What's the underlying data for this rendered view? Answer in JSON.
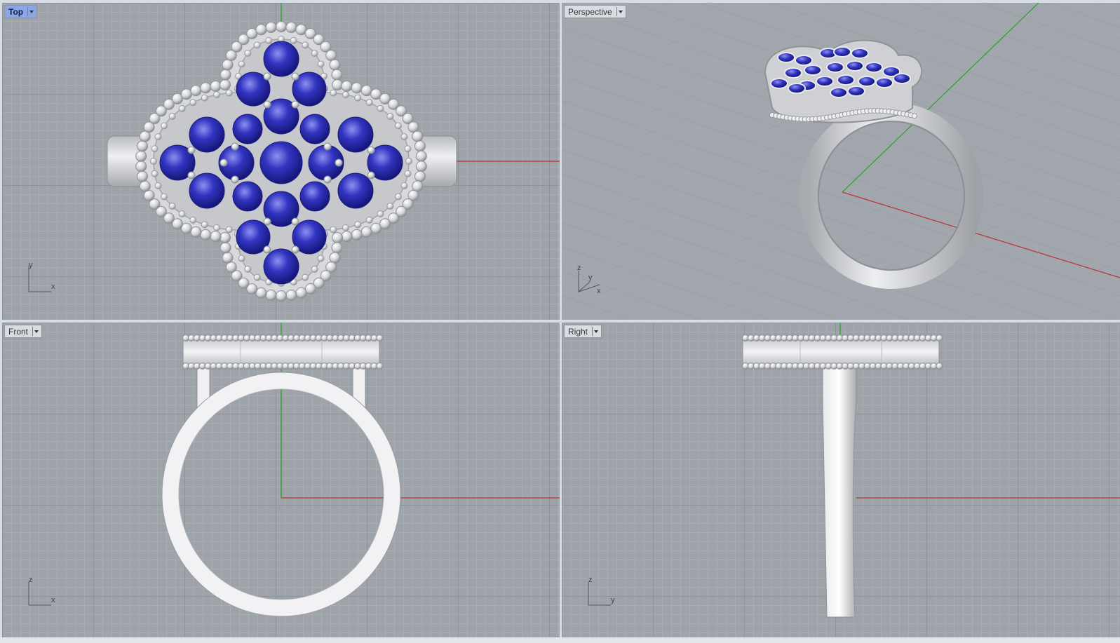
{
  "viewports": {
    "top": {
      "label": "Top",
      "axes": [
        "y",
        "x"
      ]
    },
    "perspective": {
      "label": "Perspective",
      "axes": [
        "z",
        "y",
        "x"
      ]
    },
    "front": {
      "label": "Front",
      "axes": [
        "z",
        "x"
      ]
    },
    "right": {
      "label": "Right",
      "axes": [
        "z",
        "y"
      ]
    }
  },
  "colors": {
    "viewport_bg": "#9ea3a9",
    "active_tab": "#8aa7e4",
    "gem": "#2d2fb5",
    "metal": "#e2e3e5",
    "x_axis": "#c03030",
    "y_axis": "#2aa02a"
  }
}
